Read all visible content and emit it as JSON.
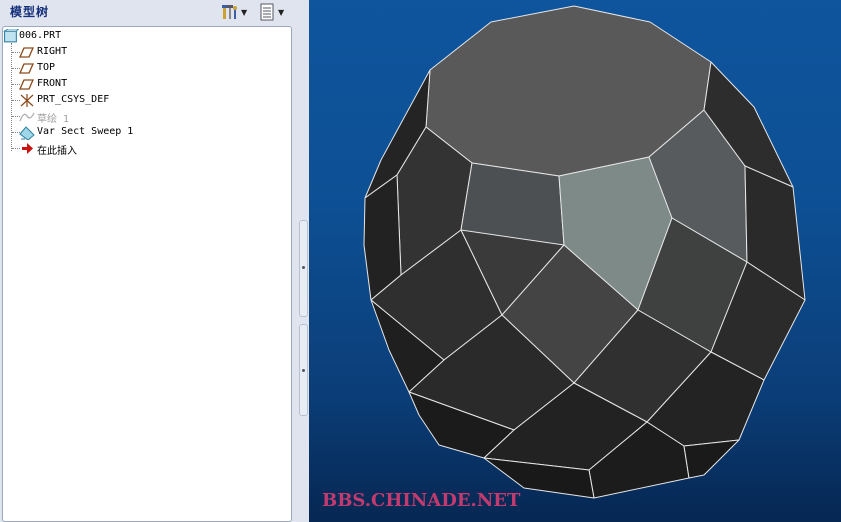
{
  "sidebar": {
    "title": "模型树",
    "tools_icon": "settings-tools-icon",
    "show_icon": "show-list-icon"
  },
  "tree": {
    "items": [
      {
        "label": "006.PRT",
        "icon": "part-icon"
      },
      {
        "label": "RIGHT",
        "icon": "datum-plane-icon"
      },
      {
        "label": "TOP",
        "icon": "datum-plane-icon"
      },
      {
        "label": "FRONT",
        "icon": "datum-plane-icon"
      },
      {
        "label": "PRT_CSYS_DEF",
        "icon": "coordinate-system-icon"
      },
      {
        "label": "草绘 1",
        "icon": "sketch-icon"
      },
      {
        "label": "Var Sect Sweep 1",
        "icon": "sweep-icon"
      },
      {
        "label": "在此插入",
        "icon": "insert-here-arrow-icon"
      }
    ]
  },
  "viewport": {
    "watermark": "BBS.CHINADE.NET",
    "background": "#0d4f93"
  },
  "colors": {
    "accent_title": "#15307a",
    "watermark": "#c23a6e",
    "insert_arrow": "#cc1111"
  }
}
